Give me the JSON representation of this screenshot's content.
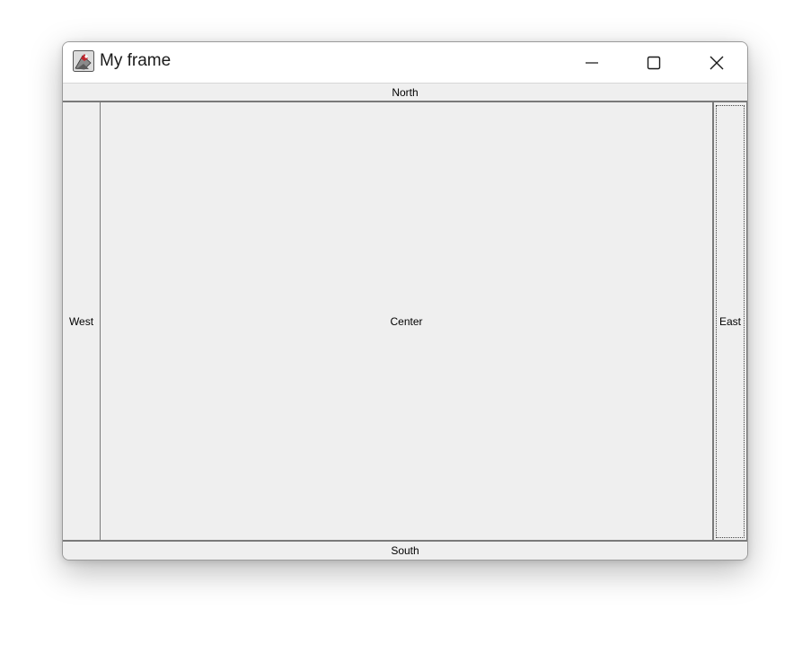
{
  "window": {
    "title": "My frame",
    "controls": {
      "minimize": "minimize-icon",
      "maximize": "maximize-icon",
      "close": "close-icon"
    }
  },
  "layout_buttons": {
    "north": "North",
    "west": "West",
    "center": "Center",
    "east": "East",
    "south": "South"
  },
  "colors": {
    "panel_bg": "#f0f0f0",
    "titlebar_bg": "#ffffff",
    "border": "#7a7a7a"
  }
}
